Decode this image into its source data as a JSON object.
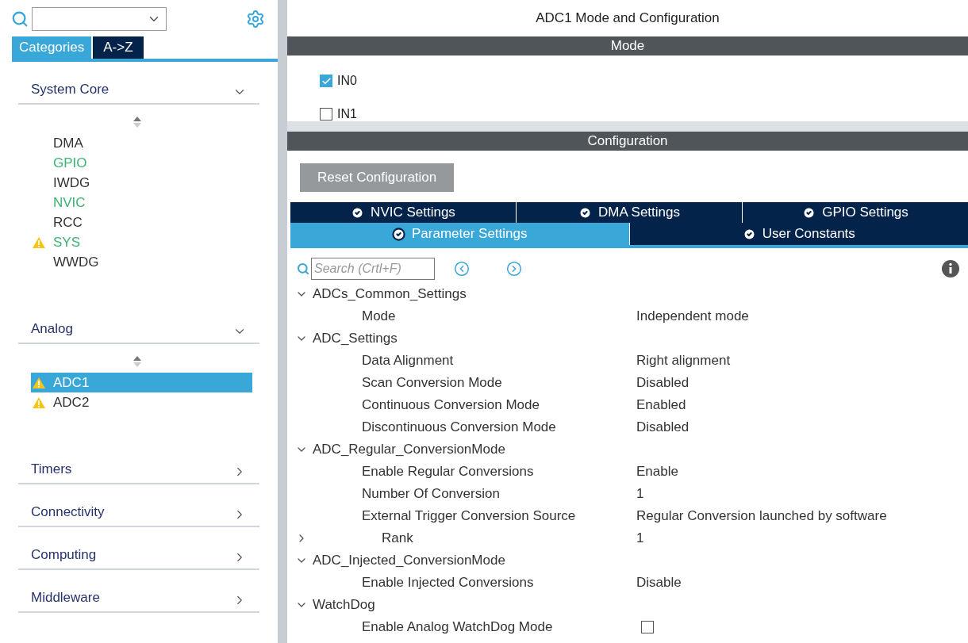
{
  "sidebar": {
    "tabs": [
      {
        "label": "Categories",
        "selected": true
      },
      {
        "label": "A->Z",
        "selected": false
      }
    ],
    "categories": [
      {
        "label": "System Core",
        "expanded": true,
        "items": [
          {
            "label": "DMA",
            "configured": false,
            "warning": false,
            "selected": false
          },
          {
            "label": "GPIO",
            "configured": true,
            "warning": false,
            "selected": false
          },
          {
            "label": "IWDG",
            "configured": false,
            "warning": false,
            "selected": false
          },
          {
            "label": "NVIC",
            "configured": true,
            "warning": false,
            "selected": false
          },
          {
            "label": "RCC",
            "configured": false,
            "warning": false,
            "selected": false
          },
          {
            "label": "SYS",
            "configured": true,
            "warning": true,
            "selected": false
          },
          {
            "label": "WWDG",
            "configured": false,
            "warning": false,
            "selected": false
          }
        ]
      },
      {
        "label": "Analog",
        "expanded": true,
        "items": [
          {
            "label": "ADC1",
            "warning": true,
            "selected": true
          },
          {
            "label": "ADC2",
            "warning": true,
            "selected": false
          }
        ]
      },
      {
        "label": "Timers",
        "expanded": false
      },
      {
        "label": "Connectivity",
        "expanded": false
      },
      {
        "label": "Computing",
        "expanded": false
      },
      {
        "label": "Middleware",
        "expanded": false
      }
    ]
  },
  "main": {
    "title": "ADC1 Mode and Configuration",
    "mode_header": "Mode",
    "mode_options": [
      {
        "label": "IN0",
        "checked": true
      },
      {
        "label": "IN1",
        "checked": false
      }
    ],
    "config_header": "Configuration",
    "reset_button": "Reset Configuration",
    "tab_rows": [
      [
        {
          "label": "NVIC Settings",
          "selected": false
        },
        {
          "label": "DMA Settings",
          "selected": false
        },
        {
          "label": "GPIO Settings",
          "selected": false
        }
      ],
      [
        {
          "label": "Parameter Settings",
          "selected": true
        },
        {
          "label": "User Constants",
          "selected": false
        }
      ]
    ],
    "search": {
      "placeholder": "Search (Crtl+F)"
    },
    "groups": [
      {
        "label": "ADCs_Common_Settings",
        "expanded": true,
        "rows": [
          {
            "name": "Mode",
            "kind": "text",
            "value": "Independent mode"
          }
        ]
      },
      {
        "label": "ADC_Settings",
        "expanded": true,
        "rows": [
          {
            "name": "Data Alignment",
            "kind": "text",
            "value": "Right alignment"
          },
          {
            "name": "Scan Conversion Mode",
            "kind": "text",
            "value": "Disabled"
          },
          {
            "name": "Continuous Conversion Mode",
            "kind": "text",
            "value": "Enabled"
          },
          {
            "name": "Discontinuous Conversion Mode",
            "kind": "text",
            "value": "Disabled"
          }
        ]
      },
      {
        "label": "ADC_Regular_ConversionMode",
        "expanded": true,
        "rows": [
          {
            "name": "Enable Regular Conversions",
            "kind": "text",
            "value": "Enable"
          },
          {
            "name": "Number Of Conversion",
            "kind": "text",
            "value": "1"
          },
          {
            "name": "External Trigger Conversion Source",
            "kind": "text",
            "value": "Regular Conversion launched by software"
          },
          {
            "name": "Rank",
            "kind": "subgroup",
            "expanded": false,
            "value": "1"
          }
        ]
      },
      {
        "label": "ADC_Injected_ConversionMode",
        "expanded": true,
        "rows": [
          {
            "name": "Enable Injected Conversions",
            "kind": "text",
            "value": "Disable"
          }
        ]
      },
      {
        "label": "WatchDog",
        "expanded": true,
        "rows": [
          {
            "name": "Enable Analog WatchDog Mode",
            "kind": "checkbox",
            "checked": false
          }
        ]
      }
    ]
  }
}
